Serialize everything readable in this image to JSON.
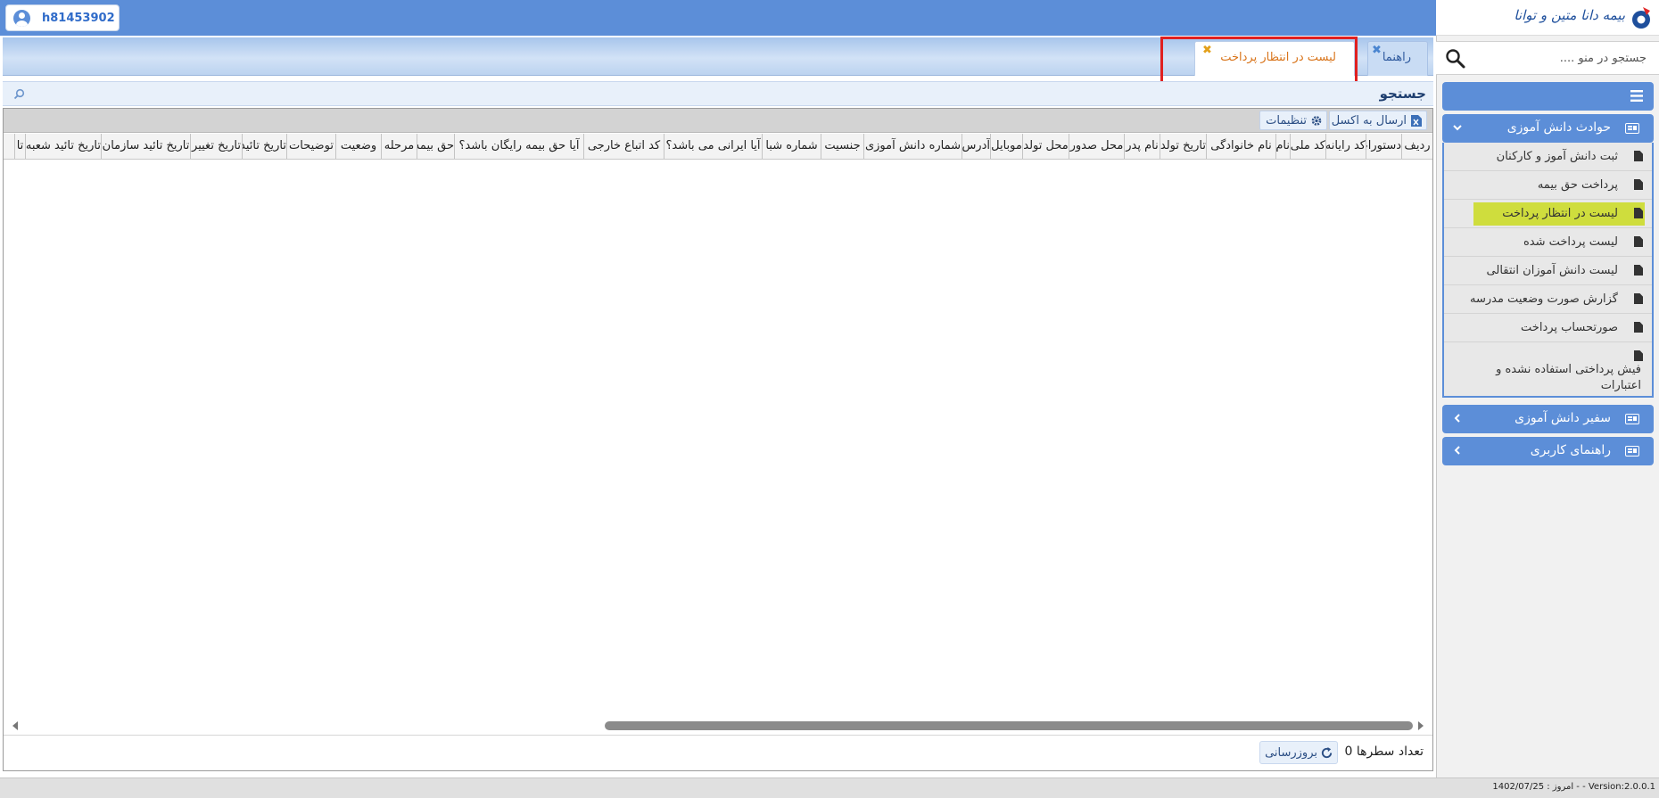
{
  "header": {
    "username": "h81453902"
  },
  "logo": {
    "text": "بیمه دانا متین و توانا"
  },
  "menu_search": {
    "placeholder": "جستجو در منو ...."
  },
  "sidebar": {
    "groups": [
      {
        "label": "حوادث دانش آموزی",
        "expanded": true,
        "items": [
          {
            "label": "ثبت دانش آموز و کارکنان",
            "active": false
          },
          {
            "label": "پرداخت حق بیمه",
            "active": false
          },
          {
            "label": "لیست در انتظار پرداخت",
            "active": true
          },
          {
            "label": "لیست پرداخت شده",
            "active": false
          },
          {
            "label": "لیست دانش آموزان انتقالی",
            "active": false
          },
          {
            "label": "گزارش صورت وضعیت مدرسه",
            "active": false
          },
          {
            "label": "صورتحساب پرداخت",
            "active": false
          },
          {
            "label": "فیش پرداختی استفاده نشده و اعتبارات",
            "active": false
          }
        ]
      },
      {
        "label": "سفیر دانش آموزی",
        "expanded": false
      },
      {
        "label": "راهنمای کاربری",
        "expanded": false
      }
    ]
  },
  "tabs": [
    {
      "label": "راهنما",
      "active": false
    },
    {
      "label": "لیست در انتظار پرداخت",
      "active": true
    }
  ],
  "search_panel": {
    "title": "جستجو"
  },
  "toolbar": {
    "excel_label": "ارسال به اکسل",
    "settings_label": "تنظیمات"
  },
  "grid": {
    "columns": [
      "ردیف",
      "دستورات",
      "کد رایانه",
      "کد ملی",
      "نام",
      "نام خانوادگی",
      "تاریخ تولد",
      "نام پدر",
      "محل صدور",
      "محل تولد",
      "موبایل",
      "آدرس",
      "شماره دانش آموزی",
      "جنسیت",
      "شماره شبا",
      "آیا ایرانی می باشد؟",
      "کد اتباع خارجی",
      "آیا حق بیمه رایگان باشد؟",
      "حق بیمه",
      "مرحله",
      "وضعیت",
      "توضیحات",
      "تاریخ تائید",
      "تاریخ تغییر",
      "تاریخ تائید سازمان",
      "تاریخ تائید شعبه",
      "تا"
    ],
    "rows": []
  },
  "footer": {
    "row_count_text": "تعداد سطرها 0",
    "refresh_label": "بروزرسانی"
  },
  "status": {
    "text": "1402/07/25 : امروز - - Version:2.0.0.1"
  },
  "colors": {
    "primary": "#5c8ed8",
    "active_item": "#cfdd3d",
    "active_tab_text": "#d9741a",
    "highlight_border": "#e02020"
  }
}
